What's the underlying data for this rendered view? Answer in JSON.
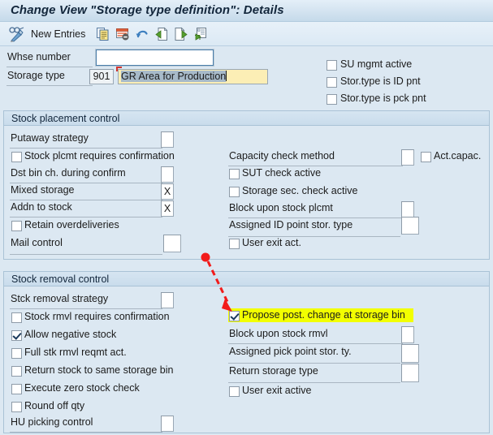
{
  "window": {
    "title": "Change View \"Storage type definition\": Details"
  },
  "toolbar": {
    "glasses_pencil_icon": "display-change-icon",
    "new_entries_label": "New Entries",
    "items": [
      {
        "icon": "copy-icon",
        "name": "copy-as-button"
      },
      {
        "icon": "delete-row-icon",
        "name": "delete-button"
      },
      {
        "icon": "undo-icon",
        "name": "undo-button"
      },
      {
        "icon": "previous-entry-icon",
        "name": "previous-entry-button"
      },
      {
        "icon": "next-entry-icon",
        "name": "next-entry-button"
      },
      {
        "icon": "other-entry-icon",
        "name": "other-entry-button"
      }
    ]
  },
  "header_form": {
    "whse_number": {
      "label": "Whse number",
      "value": ""
    },
    "storage_type": {
      "label": "Storage type",
      "key_value": "901",
      "text_value": "GR Area for Production"
    },
    "checks": [
      {
        "label": "SU mgmt active",
        "checked": false
      },
      {
        "label": "Stor.type is ID pnt",
        "checked": false
      },
      {
        "label": "Stor.type is pck pnt",
        "checked": false
      }
    ]
  },
  "placement": {
    "title": "Stock placement control",
    "left": [
      {
        "kind": "field",
        "label": "Putaway strategy",
        "value": "",
        "size": "sm"
      },
      {
        "kind": "checkbox",
        "label": "Stock plcmt requires confirmation",
        "checked": false
      },
      {
        "kind": "field",
        "label": "Dst bin ch. during confirm",
        "value": "",
        "size": "sm"
      },
      {
        "kind": "field",
        "label": "Mixed storage",
        "value": "X",
        "size": "sm"
      },
      {
        "kind": "field",
        "label": "Addn to stock",
        "value": "X",
        "size": "sm"
      },
      {
        "kind": "checkbox",
        "label": "Retain overdeliveries",
        "checked": false
      },
      {
        "kind": "field",
        "label": "Mail control",
        "value": "",
        "size": "md"
      }
    ],
    "right": [
      {
        "kind": "field",
        "label": "Capacity check method",
        "value": "",
        "size": "sm",
        "extra_checkbox": {
          "label": "Act.capac.",
          "checked": false
        }
      },
      {
        "kind": "checkbox",
        "label": "SUT check active",
        "checked": false
      },
      {
        "kind": "checkbox",
        "label": "Storage sec. check active",
        "checked": false
      },
      {
        "kind": "field",
        "label": "Block upon stock plcmt",
        "value": "",
        "size": "sm"
      },
      {
        "kind": "field",
        "label": "Assigned ID point stor. type",
        "value": "",
        "size": "md"
      },
      {
        "kind": "checkbox",
        "label": "User exit act.",
        "checked": false
      }
    ]
  },
  "removal": {
    "title": "Stock removal control",
    "left": [
      {
        "kind": "field",
        "label": "Stck removal strategy",
        "value": "",
        "size": "sm"
      },
      {
        "kind": "checkbox",
        "label": "Stock rmvl requires confirmation",
        "checked": false
      },
      {
        "kind": "checkbox",
        "label": "Allow negative stock",
        "checked": true
      },
      {
        "kind": "checkbox",
        "label": "Full stk rmvl reqmt act.",
        "checked": false
      },
      {
        "kind": "checkbox",
        "label": "Return stock to same storage bin",
        "checked": false
      },
      {
        "kind": "checkbox",
        "label": "Execute zero stock check",
        "checked": false
      },
      {
        "kind": "checkbox",
        "label": "Round off qty",
        "checked": false
      },
      {
        "kind": "field",
        "label": "HU picking control",
        "value": "",
        "size": "sm"
      }
    ],
    "right": [
      {
        "kind": "checkbox",
        "label": "Propose post. change at storage bin",
        "checked": true,
        "highlight": true
      },
      {
        "kind": "field",
        "label": "Block upon stock rmvl",
        "value": "",
        "size": "sm"
      },
      {
        "kind": "field",
        "label": "Assigned pick point stor. ty.",
        "value": "",
        "size": "md"
      },
      {
        "kind": "field",
        "label": "Return storage type",
        "value": "",
        "size": "md"
      },
      {
        "kind": "checkbox",
        "label": "User exit active",
        "checked": false
      }
    ]
  },
  "annotation": {
    "arrow_color": "#f21b1b",
    "highlight_color": "#f2ff00"
  }
}
